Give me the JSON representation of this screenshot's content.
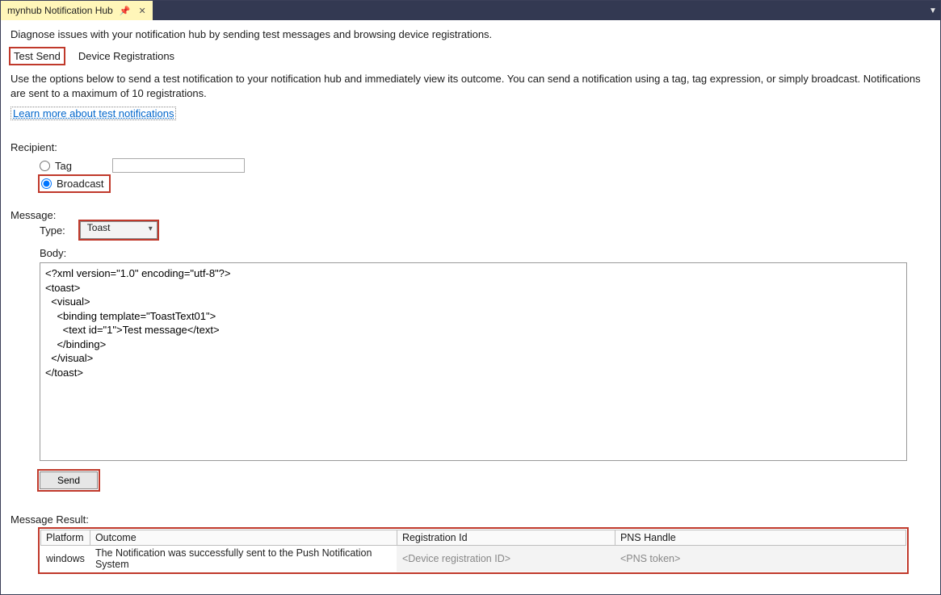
{
  "tab": {
    "title": "mynhub Notification Hub"
  },
  "intro": "Diagnose issues with your notification hub by sending test messages and browsing device registrations.",
  "subtabs": {
    "test_send": "Test Send",
    "device_registrations": "Device Registrations"
  },
  "description": "Use the options below to send a test notification to your notification hub and immediately view its outcome. You can send a notification using a tag, tag expression, or simply broadcast. Notifications are sent to a maximum of 10 registrations.",
  "learn_more": "Learn more about test notifications",
  "recipient": {
    "label": "Recipient:",
    "tag_label": "Tag",
    "tag_value": "",
    "broadcast_label": "Broadcast",
    "selected": "broadcast"
  },
  "message": {
    "label": "Message:",
    "type_label": "Type:",
    "type_value": "Toast",
    "body_label": "Body:",
    "body_value": "<?xml version=\"1.0\" encoding=\"utf-8\"?>\n<toast>\n  <visual>\n    <binding template=\"ToastText01\">\n      <text id=\"1\">Test message</text>\n    </binding>\n  </visual>\n</toast>"
  },
  "send_label": "Send",
  "result": {
    "label": "Message Result:",
    "columns": {
      "platform": "Platform",
      "outcome": "Outcome",
      "registration_id": "Registration Id",
      "pns_handle": "PNS Handle"
    },
    "rows": [
      {
        "platform": "windows",
        "outcome": "The Notification was successfully sent to the Push Notification System",
        "registration_id": "<Device registration ID>",
        "pns_handle": "<PNS token>"
      }
    ]
  }
}
